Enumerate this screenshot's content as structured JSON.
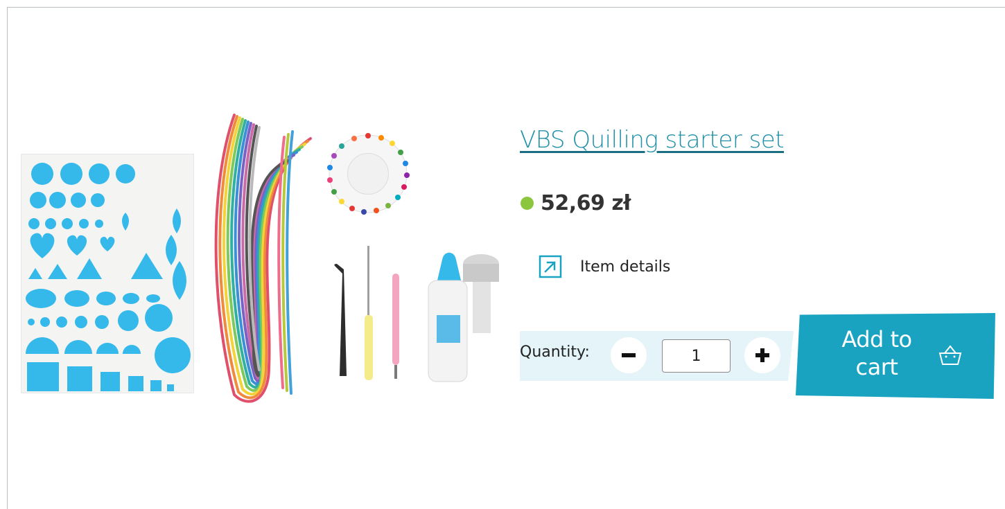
{
  "product": {
    "title": "VBS Quilling starter set",
    "price": "52,69 zł",
    "availability_color": "#8cc63f",
    "details_label": "Item details",
    "details_icon": "external-link-arrow-icon"
  },
  "cart": {
    "quantity_label": "Quantity:",
    "quantity_value": "1",
    "decrement_icon": "minus-icon",
    "increment_icon": "plus-icon",
    "add_label": "Add to cart",
    "cart_icon": "basket-icon",
    "accent_color": "#1aa3c1",
    "band_color": "#e4f4f8"
  },
  "colors": {
    "title": "#2090a8",
    "template_shapes": "#35b8ea"
  }
}
